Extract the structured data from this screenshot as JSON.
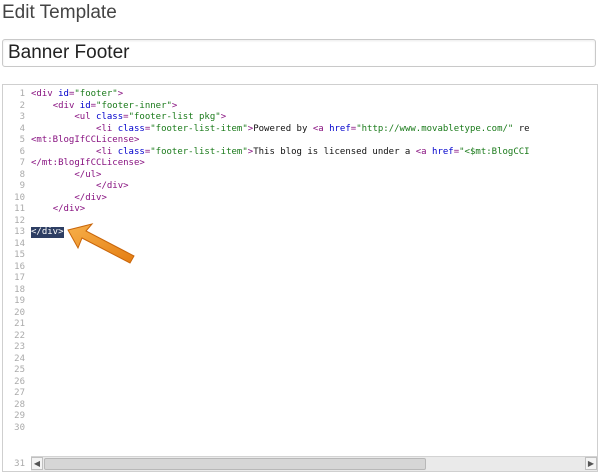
{
  "page": {
    "title": "Edit Template"
  },
  "template_name": {
    "value": "Banner Footer"
  },
  "editor": {
    "lines": [
      {
        "n": "1",
        "tokens": [
          [
            "tag",
            "<div "
          ],
          [
            "attr",
            "id"
          ],
          [
            "tag",
            "="
          ],
          [
            "str",
            "\"footer\""
          ],
          [
            "tag",
            ">"
          ]
        ]
      },
      {
        "n": "2",
        "tokens": [
          [
            "txt",
            "    "
          ],
          [
            "tag",
            "<div "
          ],
          [
            "attr",
            "id"
          ],
          [
            "tag",
            "="
          ],
          [
            "str",
            "\"footer-inner\""
          ],
          [
            "tag",
            ">"
          ]
        ]
      },
      {
        "n": "3",
        "tokens": [
          [
            "txt",
            "        "
          ],
          [
            "tag",
            "<ul "
          ],
          [
            "attr",
            "class"
          ],
          [
            "tag",
            "="
          ],
          [
            "str",
            "\"footer-list pkg\""
          ],
          [
            "tag",
            ">"
          ]
        ]
      },
      {
        "n": "4",
        "tokens": [
          [
            "txt",
            "            "
          ],
          [
            "tag",
            "<li "
          ],
          [
            "attr",
            "class"
          ],
          [
            "tag",
            "="
          ],
          [
            "str",
            "\"footer-list-item\""
          ],
          [
            "tag",
            ">"
          ],
          [
            "txt",
            "Powered by "
          ],
          [
            "tag",
            "<a "
          ],
          [
            "attr",
            "href"
          ],
          [
            "tag",
            "="
          ],
          [
            "str",
            "\"http://www.movabletype.com/\""
          ],
          [
            "txt",
            " re"
          ]
        ]
      },
      {
        "n": "5",
        "tokens": [
          [
            "tag",
            "<mt:BlogIfCCLicense>"
          ]
        ]
      },
      {
        "n": "6",
        "tokens": [
          [
            "txt",
            "            "
          ],
          [
            "tag",
            "<li "
          ],
          [
            "attr",
            "class"
          ],
          [
            "tag",
            "="
          ],
          [
            "str",
            "\"footer-list-item\""
          ],
          [
            "tag",
            ">"
          ],
          [
            "txt",
            "This blog is licensed under a "
          ],
          [
            "tag",
            "<a "
          ],
          [
            "attr",
            "href"
          ],
          [
            "tag",
            "="
          ],
          [
            "str",
            "\"<$mt:BlogCCI"
          ]
        ]
      },
      {
        "n": "7",
        "tokens": [
          [
            "tag",
            "</mt:BlogIfCCLicense>"
          ]
        ]
      },
      {
        "n": "8",
        "tokens": [
          [
            "txt",
            "        "
          ],
          [
            "tag",
            "</ul>"
          ]
        ]
      },
      {
        "n": "9",
        "tokens": [
          [
            "txt",
            "            "
          ],
          [
            "tag",
            "</div>"
          ]
        ]
      },
      {
        "n": "10",
        "tokens": [
          [
            "txt",
            "        "
          ],
          [
            "tag",
            "</div>"
          ]
        ]
      },
      {
        "n": "11",
        "tokens": [
          [
            "txt",
            "    "
          ],
          [
            "tag",
            "</div>"
          ]
        ]
      },
      {
        "n": "12",
        "tokens": []
      },
      {
        "n": "13",
        "tokens": [
          [
            "tag",
            "</div>"
          ]
        ],
        "selected": true
      },
      {
        "n": "14",
        "tokens": []
      },
      {
        "n": "15",
        "tokens": []
      },
      {
        "n": "16",
        "tokens": []
      },
      {
        "n": "17",
        "tokens": []
      },
      {
        "n": "18",
        "tokens": []
      },
      {
        "n": "19",
        "tokens": []
      },
      {
        "n": "20",
        "tokens": []
      },
      {
        "n": "21",
        "tokens": []
      },
      {
        "n": "22",
        "tokens": []
      },
      {
        "n": "23",
        "tokens": []
      },
      {
        "n": "24",
        "tokens": []
      },
      {
        "n": "25",
        "tokens": []
      },
      {
        "n": "26",
        "tokens": []
      },
      {
        "n": "27",
        "tokens": []
      },
      {
        "n": "28",
        "tokens": []
      },
      {
        "n": "29",
        "tokens": []
      },
      {
        "n": "30",
        "tokens": []
      }
    ],
    "last_line_number": "31",
    "scroll_left_glyph": "◀",
    "scroll_right_glyph": "▶"
  },
  "colors": {
    "selection": "#2d3e63",
    "pointer": "#f0931e"
  },
  "icons": {
    "pointer": "arrow-pointer-icon"
  }
}
